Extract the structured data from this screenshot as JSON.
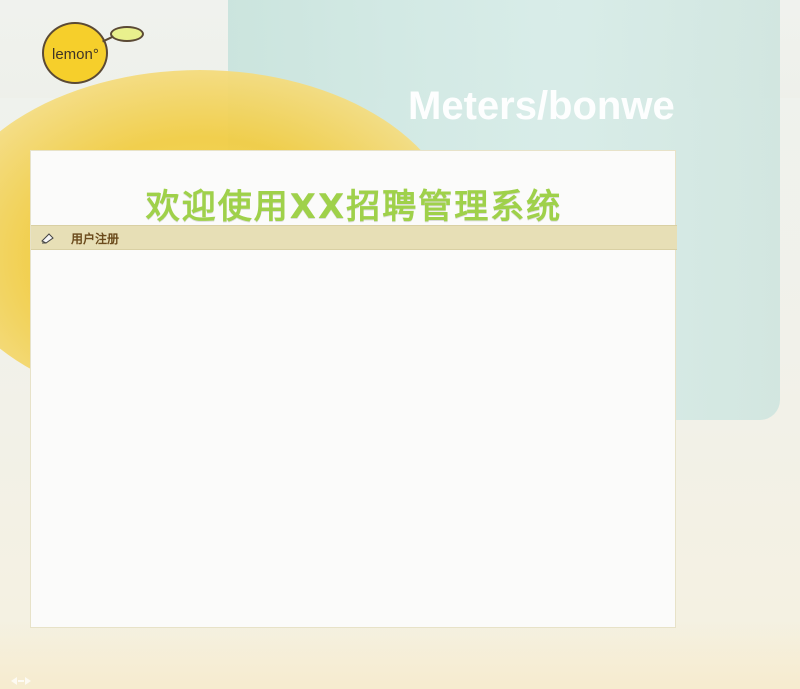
{
  "logo": {
    "text": "lemon°"
  },
  "background": {
    "cup_brand_text": "Meters/bonwe"
  },
  "panel": {
    "title": "欢迎使用XX招聘管理系统",
    "section_label": "用户注册"
  },
  "colors": {
    "title_green": "#9fd14a",
    "section_bar": "#e7dfb6",
    "section_text": "#6b4b1c",
    "panel_bg": "#fbfbfa"
  },
  "icons": {
    "section_icon": "edit-icon",
    "bottom_icon": "small-arrows-icon"
  }
}
